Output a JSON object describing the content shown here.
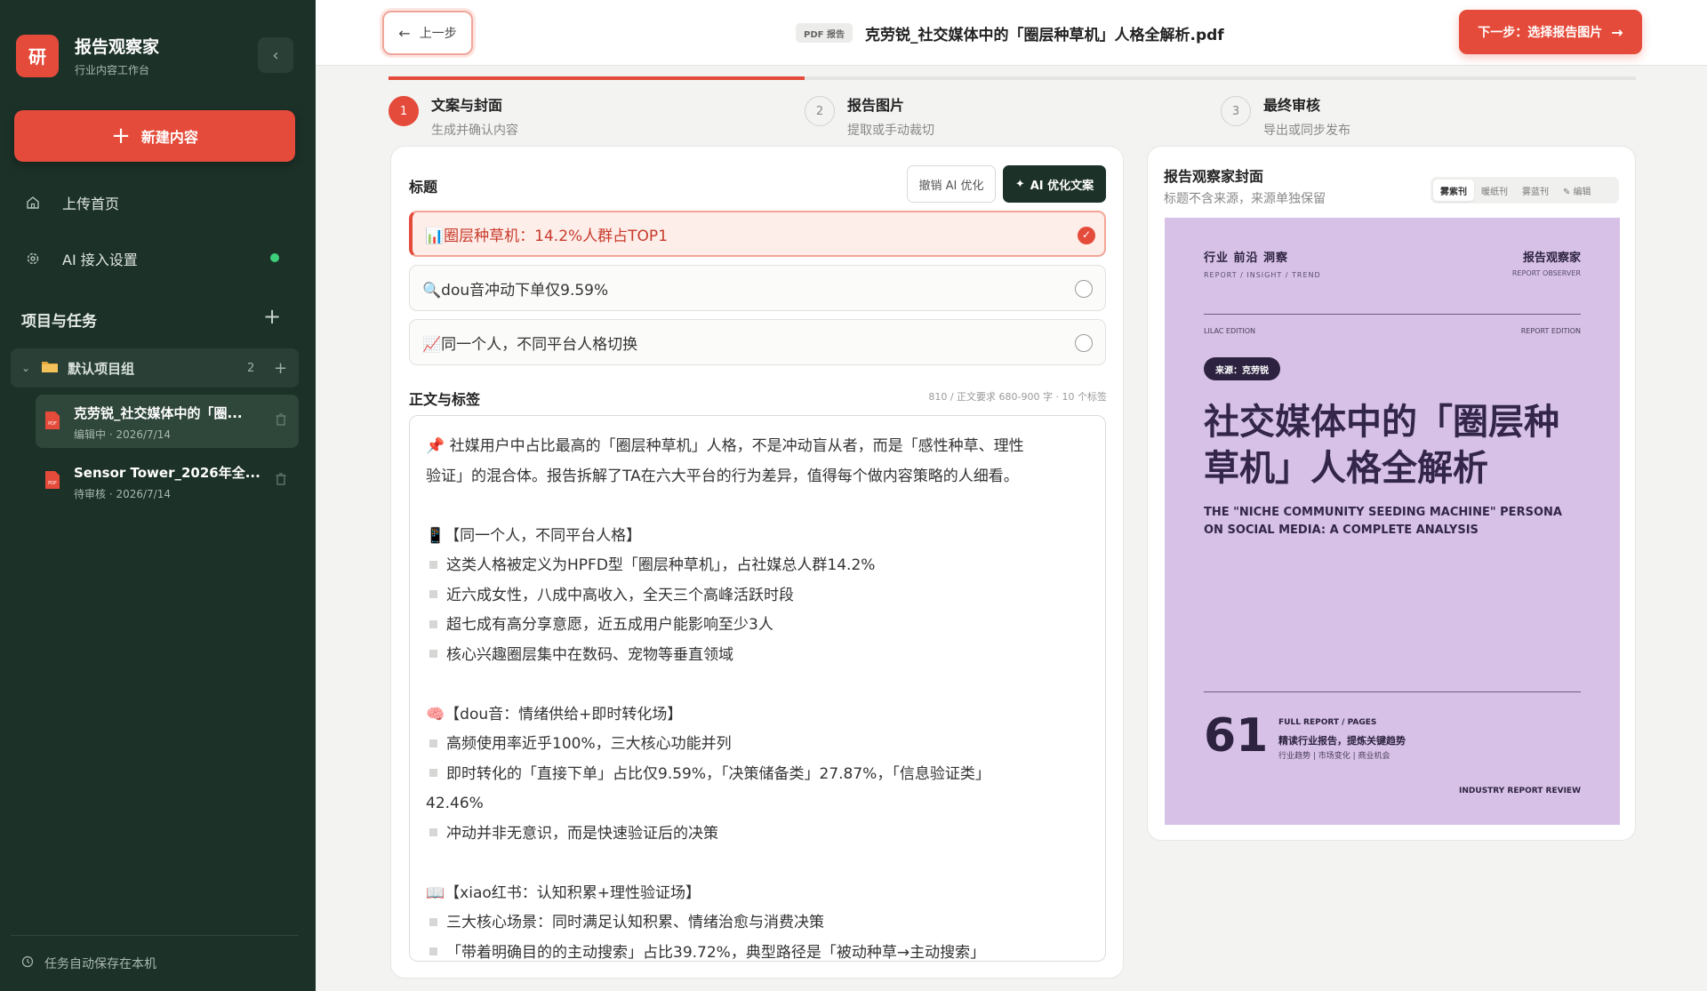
{
  "sidebar": {
    "logo_char": "研",
    "brand_title": "报告观察家",
    "brand_sub": "行业内容工作台",
    "new_button": "新建内容",
    "nav": {
      "upload": "上传首页",
      "ai_settings": "AI 接入设置"
    },
    "ai_status_color": "#3ecf7a",
    "section_title": "项目与任务",
    "group": {
      "name": "默认项目组",
      "count": "2"
    },
    "tasks": [
      {
        "title": "克劳锐_社交媒体中的「圈...",
        "meta": "编辑中 · 2026/7/14"
      },
      {
        "title": "Sensor Tower_2026年全...",
        "meta": "待审核 · 2026/7/14"
      }
    ],
    "autosave": "任务自动保存在本机"
  },
  "topbar": {
    "back_label": "上一步",
    "file_badge": "PDF 报告",
    "file_title": "克劳锐_社交媒体中的「圈层种草机」人格全解析.pdf",
    "next_label": "下一步：选择报告图片"
  },
  "steps": [
    {
      "num": "1",
      "title": "文案与封面",
      "sub": "生成并确认内容"
    },
    {
      "num": "2",
      "title": "报告图片",
      "sub": "提取或手动裁切"
    },
    {
      "num": "3",
      "title": "最终审核",
      "sub": "导出或同步发布"
    }
  ],
  "progress": {
    "current_step": 1,
    "total_steps": 3
  },
  "editor": {
    "title_label": "标题",
    "undo_ai": "撤销 AI 优化",
    "ai_optimize": "AI 优化文案",
    "options": [
      {
        "text": "📊圈层种草机：14.2%人群占TOP1",
        "selected": true
      },
      {
        "text": "🔍dou音冲动下单仅9.59%",
        "selected": false
      },
      {
        "text": "📈同一个人，不同平台人格切换",
        "selected": false
      }
    ],
    "body_label": "正文与标签",
    "body_stats": "810 / 正文要求 680-900 字 · 10 个标签",
    "body_lines": [
      {
        "text": "📌 社媒用户中占比最高的「圈层种草机」人格，不是冲动盲从者，而是「感性种草、理性",
        "bullet": false
      },
      {
        "text": "验证」的混合体。报告拆解了TA在六大平台的行为差异，值得每个做内容策略的人细看。",
        "bullet": false
      },
      {
        "text": "",
        "bullet": false
      },
      {
        "text": "📱【同一个人，不同平台人格】",
        "bullet": false
      },
      {
        "text": "这类人格被定义为HPFD型「圈层种草机」，占社媒总人群14.2%",
        "bullet": true
      },
      {
        "text": "近六成女性，八成中高收入，全天三个高峰活跃时段",
        "bullet": true
      },
      {
        "text": "超七成有高分享意愿，近五成用户能影响至少3人",
        "bullet": true
      },
      {
        "text": "核心兴趣圈层集中在数码、宠物等垂直领域",
        "bullet": true
      },
      {
        "text": "",
        "bullet": false
      },
      {
        "text": "🧠【dou音：情绪供给+即时转化场】",
        "bullet": false
      },
      {
        "text": "高频使用率近乎100%，三大核心功能并列",
        "bullet": true
      },
      {
        "text": "即时转化的「直接下单」占比仅9.59%，「决策储备类」27.87%，「信息验证类」",
        "bullet": true
      },
      {
        "text": "42.46%",
        "bullet": false
      },
      {
        "text": "冲动并非无意识，而是快速验证后的决策",
        "bullet": true
      },
      {
        "text": "",
        "bullet": false
      },
      {
        "text": "📖【xiao红书：认知积累+理性验证场】",
        "bullet": false
      },
      {
        "text": "三大核心场景：同时满足认知积累、情绪治愈与消费决策",
        "bullet": true
      },
      {
        "text": "「带着明确目的的主动搜索」占比39.72%，典型路径是「被动种草→主动搜索」",
        "bullet": true
      }
    ]
  },
  "cover_panel": {
    "title": "报告观察家封面",
    "sub": "标题不含来源，来源单独保留",
    "themes": [
      "雾紫刊",
      "暖纸刊",
      "雾蓝刊",
      "✎ 编辑"
    ],
    "active_theme": "雾紫刊",
    "cover": {
      "bg_color": "#d7c1e6",
      "tags_cn": "行业  前沿  洞察",
      "tags_en": "REPORT / INSIGHT / TREND",
      "brand_cn": "报告观察家",
      "brand_en": "REPORT OBSERVER",
      "edition_left": "LILAC EDITION",
      "edition_right": "REPORT EDITION",
      "source": "来源：克劳锐",
      "headline": "社交媒体中的「圈层种草机」人格全解析",
      "headline_en": "THE \"NICHE COMMUNITY SEEDING MACHINE\" PERSONA ON SOCIAL MEDIA: A COMPLETE ANALYSIS",
      "pages": "61",
      "full_report": "FULL REPORT / PAGES",
      "tagline": "精读行业报告，提炼关键趋势",
      "keywords": "行业趋势 | 市场变化 | 商业机会",
      "review": "INDUSTRY REPORT REVIEW"
    }
  }
}
